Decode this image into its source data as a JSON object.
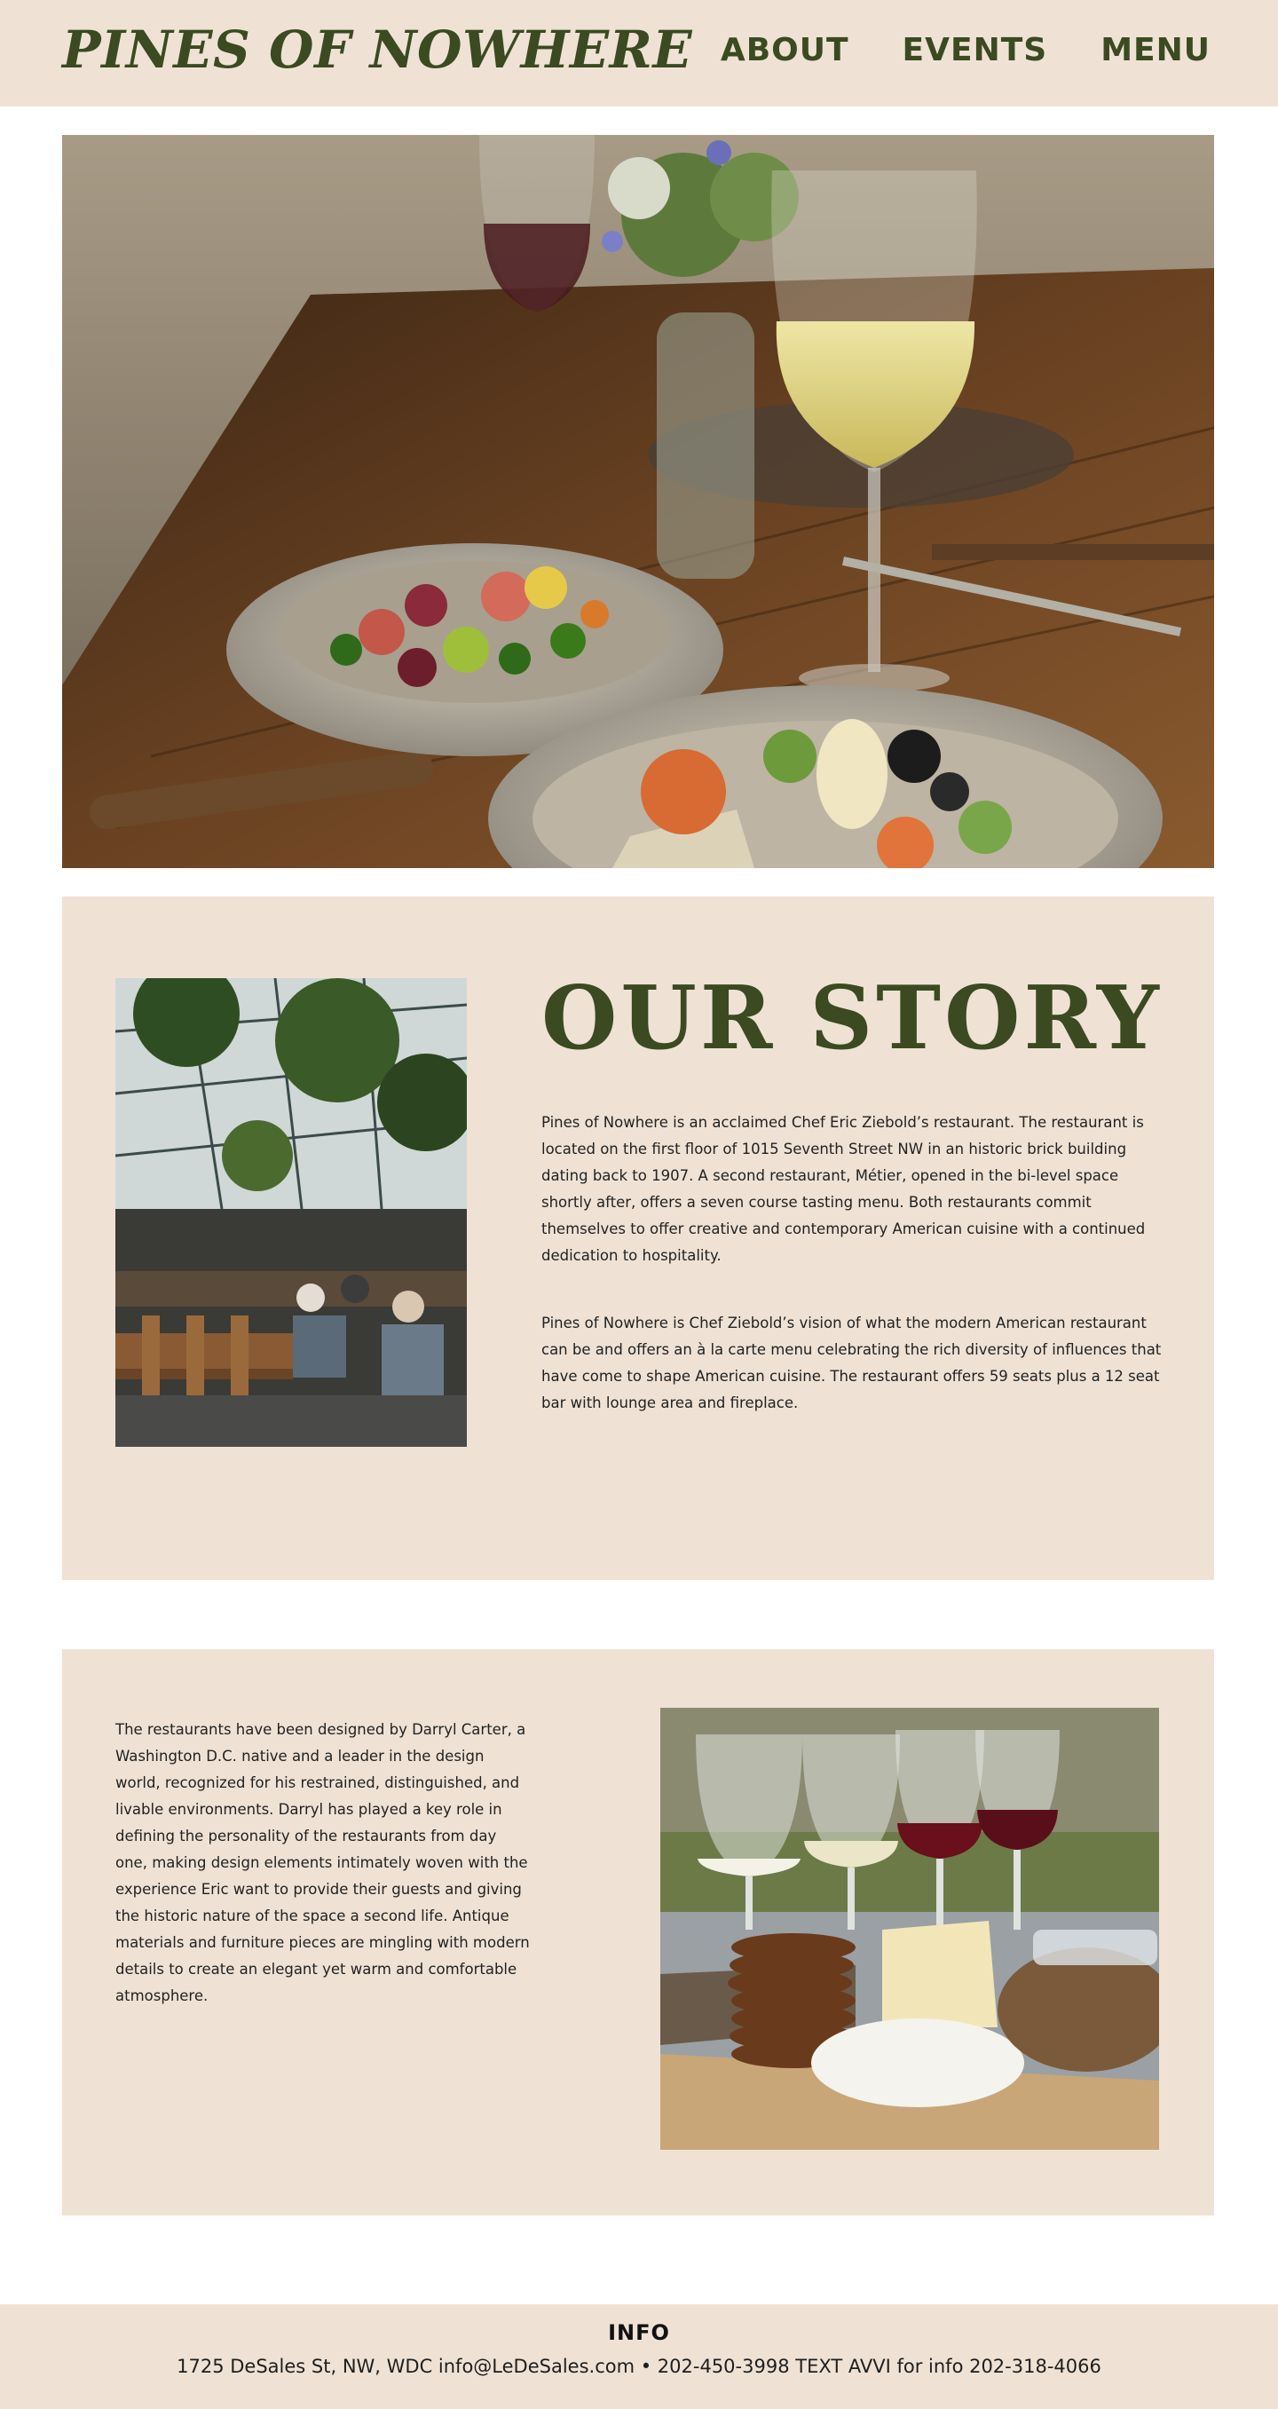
{
  "header": {
    "brand": "PINES OF NOWHERE",
    "nav": [
      {
        "label": "ABOUT"
      },
      {
        "label": "EVENTS"
      },
      {
        "label": "MENU"
      }
    ]
  },
  "story": {
    "title": "OUR STORY",
    "paragraph1": "Pines of Nowhere is an acclaimed Chef Eric Ziebold’s restaurant. The restaurant is located on the first floor of 1015 Seventh Street NW in an historic brick building dating back to 1907. A second restaurant, Métier, opened in the bi-level space shortly after, offers a seven course tasting menu. Both restaurants commit themselves to offer creative and contemporary American cuisine with a continued dedication to hospitality.",
    "paragraph2": "Pines of Nowhere is Chef Ziebold’s vision of what the modern American restaurant can be and offers an à la carte menu celebrating the rich diversity of influences that have come to shape American cuisine. The restaurant offers 59 seats plus a 12 seat bar with lounge area and fireplace."
  },
  "design": {
    "paragraph": "The restaurants have been designed by Darryl Carter, a Washington D.C. native and a leader in the design world, recognized for his restrained, distinguished, and livable environments. Darryl has played a key role in defining the personality of the restaurants from day one, making design elements intimately woven with the experience Eric want to provide their guests and giving the historic nature of the space a second life. Antique materials and furniture pieces are mingling with modern details to create an elegant yet warm and comfortable atmosphere."
  },
  "footer": {
    "title": "INFO",
    "line": "1725 DeSales St, NW, WDC  info@LeDeSales.com • 202-450-3998  TEXT AVVI for info  202-318-4066"
  },
  "colors": {
    "accent": "#3b4a21",
    "panel": "#efe2d5"
  }
}
